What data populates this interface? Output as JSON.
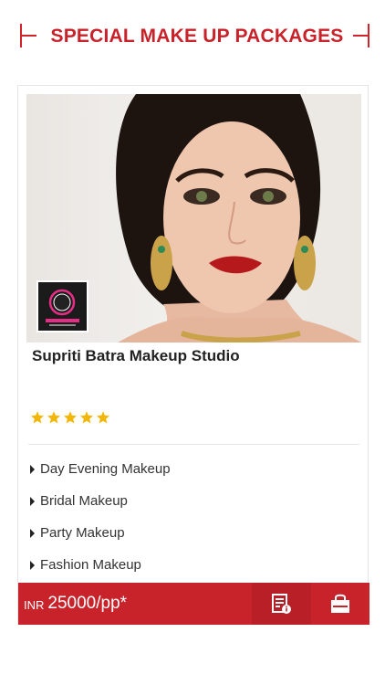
{
  "header": {
    "title": "SPECIAL MAKE UP PACKAGES"
  },
  "card": {
    "name": "Supriti Batra Makeup Studio",
    "rating": 5,
    "features": [
      "Day Evening Makeup",
      "Bridal Makeup",
      "Party Makeup",
      "Fashion Makeup"
    ],
    "price": {
      "currency": "INR",
      "amount": "25000/pp*"
    },
    "actions": {
      "details_icon": "document-info-icon",
      "cart_icon": "shopping-bag-icon"
    }
  },
  "colors": {
    "accent": "#c8232a",
    "star": "#f2b705"
  }
}
